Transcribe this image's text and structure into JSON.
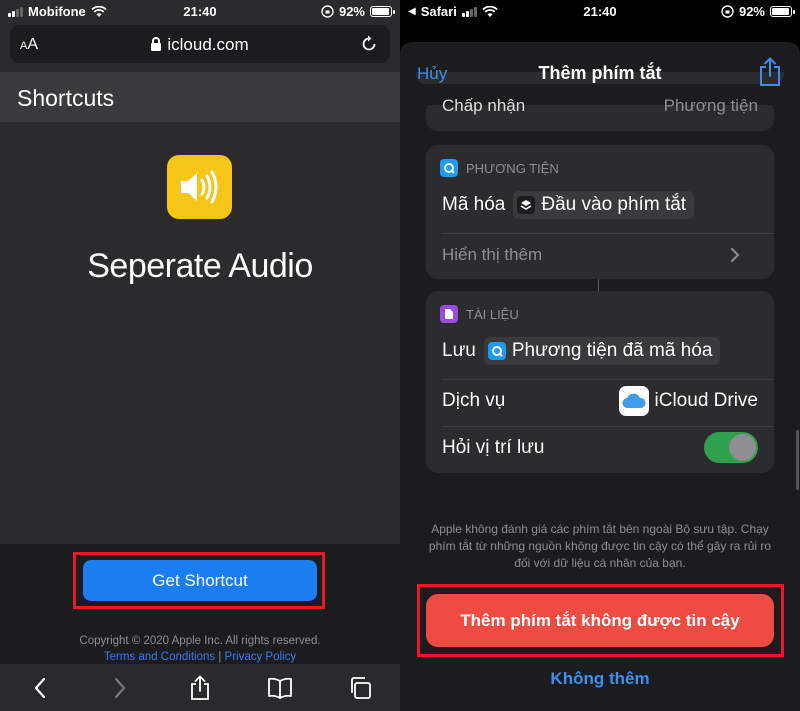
{
  "left": {
    "status": {
      "carrier": "Mobifone",
      "time": "21:40",
      "battery": "92%"
    },
    "url": {
      "aa_small": "A",
      "aa_big": "A",
      "domain": "icloud.com"
    },
    "header_title": "Shortcuts",
    "shortcut_name": "Seperate Audio",
    "icon_color": "#f5c518",
    "get_button": "Get Shortcut",
    "copyright": "Copyright © 2020 Apple Inc.  All rights reserved.",
    "terms": "Terms and Conditions",
    "separator": "|",
    "privacy": "Privacy Policy",
    "toolbar_icons": [
      "back-icon",
      "forward-icon",
      "share-icon",
      "bookmarks-icon",
      "tabs-icon"
    ]
  },
  "right": {
    "status": {
      "back_app": "Safari",
      "time": "21:40",
      "battery": "92%"
    },
    "nav": {
      "cancel": "Hủy",
      "title": "Thêm phím tắt"
    },
    "accept_row": {
      "label": "Chấp nhận",
      "value": "Phương tiện"
    },
    "media_card": {
      "section": "PHƯƠNG TIỆN",
      "action": "Mã hóa",
      "chip": "Đầu vào phím tắt",
      "show_more": "Hiển thị thêm"
    },
    "doc_card": {
      "section": "TÀI LIỆU",
      "action": "Lưu",
      "chip": "Phương tiện đã mã hóa",
      "service_label": "Dịch vụ",
      "service_value": "iCloud Drive",
      "ask_label": "Hỏi vị trí lưu",
      "ask_enabled": true
    },
    "disclaimer": "Apple không đánh giá các phím tắt bên ngoài Bộ sưu tập. Chạy phím tắt từ những nguồn không được tin cậy có thể gây ra rủi ro đối với dữ liệu cá nhân của bạn.",
    "add_untrusted": "Thêm phím tắt không được tin cậy",
    "dont_add": "Không thêm",
    "accent": "#3b8ff0",
    "danger": "#ee4b42"
  }
}
